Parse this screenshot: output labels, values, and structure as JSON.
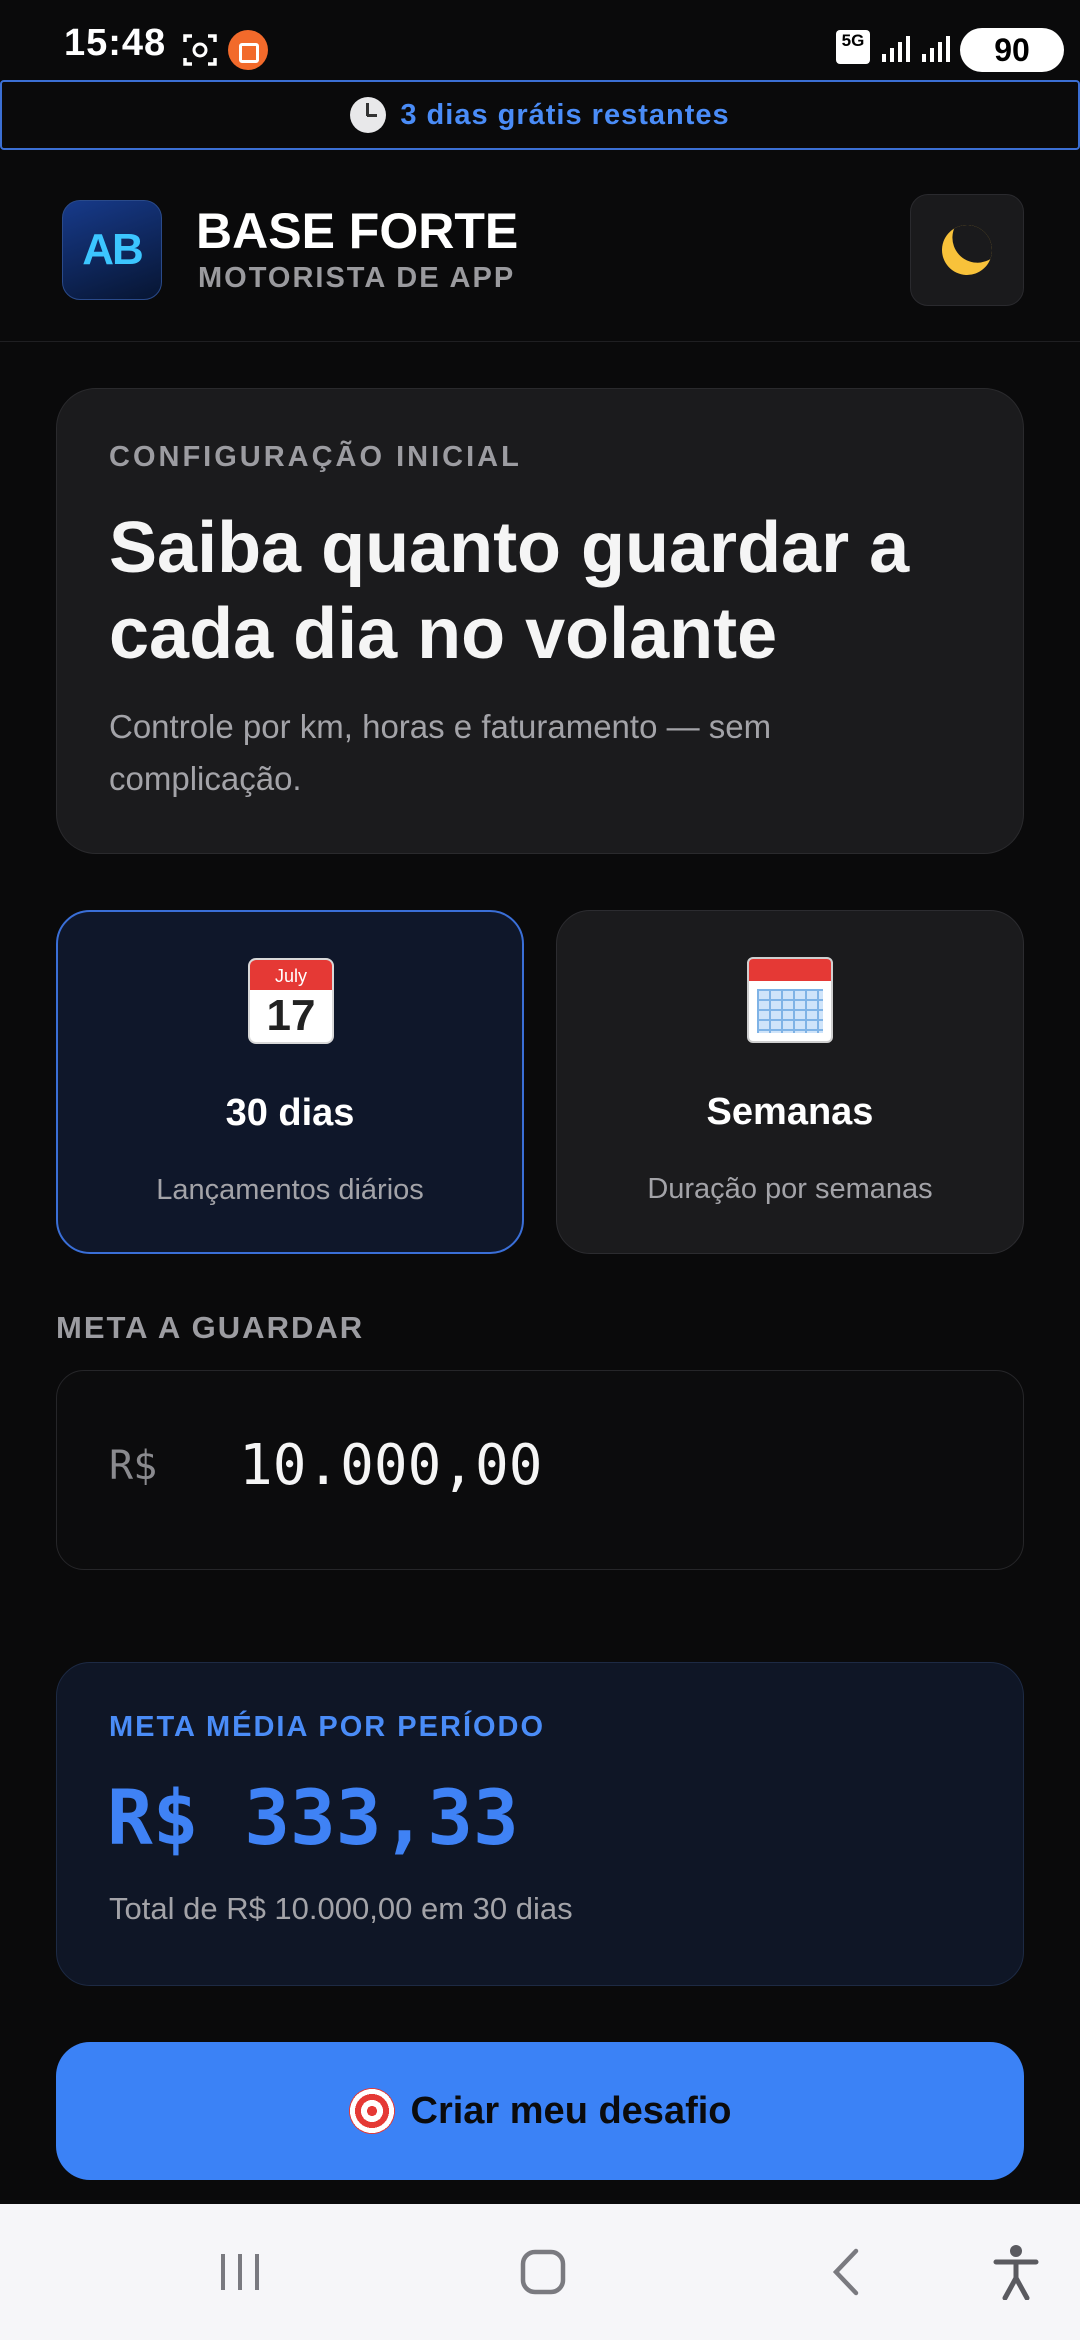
{
  "status_bar": {
    "time": "15:48",
    "network": "5G",
    "battery": "90"
  },
  "trial_banner": {
    "icon": "clock-icon",
    "text": "3 dias grátis restantes"
  },
  "header": {
    "logo_text": "AB",
    "title": "BASE FORTE",
    "subtitle": "MOTORISTA DE APP",
    "theme_icon": "moon-icon"
  },
  "intro": {
    "eyebrow": "CONFIGURAÇÃO INICIAL",
    "headline": "Saiba quanto guardar a cada dia no volante",
    "description": "Controle por km, horas e faturamento — sem complicação."
  },
  "modes": [
    {
      "icon": "calendar-day-icon",
      "icon_month": "July",
      "icon_day": "17",
      "title": "30 dias",
      "subtitle": "Lançamentos diários",
      "selected": true
    },
    {
      "icon": "spiral-calendar-icon",
      "title": "Semanas",
      "subtitle": "Duração por semanas",
      "selected": false
    }
  ],
  "goal": {
    "label": "META A GUARDAR",
    "currency": "R$",
    "value": "10.000,00"
  },
  "summary": {
    "label": "META MÉDIA POR PERÍODO",
    "amount": "R$ 333,33",
    "note": "Total de R$ 10.000,00 em 30 dias"
  },
  "cta": {
    "icon": "target-icon",
    "label": "Criar meu desafio"
  },
  "colors": {
    "accent": "#3b82f6",
    "background": "#0a0a0b",
    "card": "#1b1b1d"
  }
}
